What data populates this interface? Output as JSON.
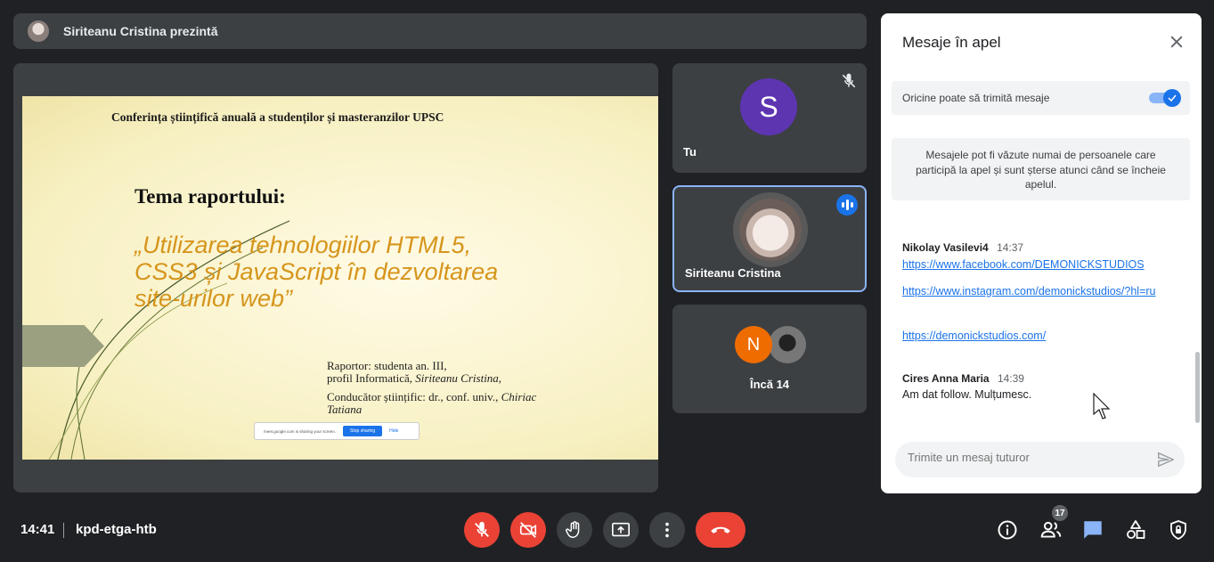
{
  "presenter": {
    "label": "Siriteanu Cristina prezintă"
  },
  "slide": {
    "header": "Conferința științifică anuală a studenților și masteranzilor UPSC",
    "theme_label": "Tema raportului:",
    "title_lines": [
      "„Utilizarea tehnologiilor HTML5,",
      "CSS3 și JavaScript în dezvoltarea",
      "site-urilor web”"
    ],
    "reporter_line1": "Raportor: studenta an. III,",
    "reporter_line2_prefix": "profil Informatică, ",
    "reporter_name": "Siriteanu Cristina,",
    "advisor_line_prefix": "Conducător științific: dr., conf. univ., ",
    "advisor_name_1": "Chiriac",
    "advisor_name_2": "Tatiana",
    "sharing_text": "meet.google.com is sharing your screen.",
    "stop_sharing": "Stop sharing",
    "hide": "Hide"
  },
  "participants": {
    "you": {
      "initial": "S",
      "name": "Tu"
    },
    "active": {
      "name": "Siriteanu Cristina"
    },
    "more": {
      "initial": "N",
      "label": "Încă 14"
    }
  },
  "chat": {
    "title": "Mesaje în apel",
    "toggle_label": "Oricine poate să trimită mesaje",
    "toggle_on": true,
    "notice": "Mesajele pot fi văzute numai de persoanele care participă la apel și sunt șterse atunci când se încheie apelul.",
    "messages": [
      {
        "sender": "Nikolay Vasilevi4",
        "time": "14:37",
        "links": [
          "https://www.facebook.com/DEMONICKSTUDIOS",
          "https://www.instagram.com/demonickstudios/?hl=ru",
          "https://demonickstudios.com/"
        ]
      },
      {
        "sender": "Cires Anna Maria",
        "time": "14:39",
        "text": "Am dat follow. Mulțumesc."
      }
    ],
    "input_placeholder": "Trimite un mesaj tuturor"
  },
  "bottom": {
    "time": "14:41",
    "meeting_code": "kpd-etga-htb",
    "participant_count": "17"
  },
  "icons": {
    "mic": "mic-off-icon",
    "camera": "camera-off-icon",
    "hand": "raise-hand-icon",
    "present": "present-screen-icon",
    "more": "more-vert-icon",
    "end": "end-call-icon",
    "info": "info-icon",
    "people": "people-icon",
    "chat": "chat-icon",
    "activities": "activities-icon",
    "safety": "host-controls-icon"
  },
  "colors": {
    "background": "#202124",
    "surface": "#3c4043",
    "danger": "#ea4335",
    "accent": "#1a73e8",
    "active_border": "#8ab4f8",
    "slide_title": "#d6951c"
  }
}
